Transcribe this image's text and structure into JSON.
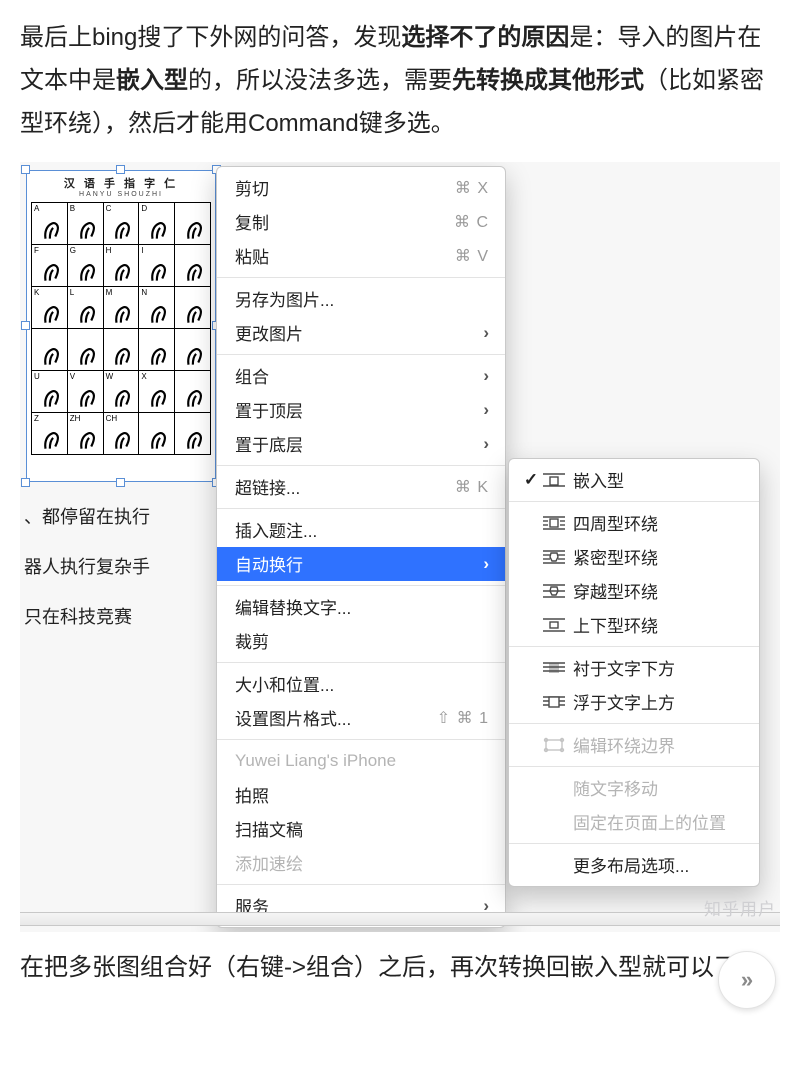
{
  "article": {
    "p1_a": "最后上bing搜了下外网的问答，发现",
    "p1_b": "选择不了的原因",
    "p1_c": "是：导入的图片在文本中是",
    "p1_d": "嵌入型",
    "p1_e": "的，所以没法多选，需要",
    "p1_f": "先转换成其他形式",
    "p1_g": "（比如紧密型环绕），然后才能用Command键多选。",
    "p2": "在把多张图组合好（右键->组合）之后，再次转换回嵌入型就可以了。"
  },
  "sign_chart": {
    "title": "汉 语 手 指 字 仁",
    "subtitle": "HANYU  SHOUZHI",
    "cells": [
      "A",
      "B",
      "C",
      "D",
      "",
      "F",
      "G",
      "H",
      "I",
      "",
      "K",
      "L",
      "M",
      "N",
      "",
      "",
      "",
      "",
      "",
      "",
      "U",
      "V",
      "W",
      "X",
      "",
      "Z",
      "ZH",
      "CH",
      "",
      ""
    ]
  },
  "doc_lines": {
    "l1": "、都停留在执行",
    "l2": "器人执行复杂手",
    "l3": "只在科技竞赛"
  },
  "menu": {
    "cut": {
      "label": "剪切",
      "shortcut": "⌘ X"
    },
    "copy": {
      "label": "复制",
      "shortcut": "⌘ C"
    },
    "paste": {
      "label": "粘贴",
      "shortcut": "⌘ V"
    },
    "save_as_picture": {
      "label": "另存为图片..."
    },
    "change_picture": {
      "label": "更改图片"
    },
    "group": {
      "label": "组合"
    },
    "bring_front": {
      "label": "置于顶层"
    },
    "send_back": {
      "label": "置于底层"
    },
    "hyperlink": {
      "label": "超链接...",
      "shortcut": "⌘ K"
    },
    "insert_caption": {
      "label": "插入题注..."
    },
    "wrap_text": {
      "label": "自动换行"
    },
    "edit_alt_text": {
      "label": "编辑替换文字..."
    },
    "crop": {
      "label": "裁剪"
    },
    "size_position": {
      "label": "大小和位置..."
    },
    "format_picture": {
      "label": "设置图片格式...",
      "shortcut": "⇧ ⌘ 1"
    },
    "iphone": {
      "label": "Yuwei Liang's iPhone"
    },
    "take_photo": {
      "label": "拍照"
    },
    "scan_documents": {
      "label": "扫描文稿"
    },
    "add_sketch": {
      "label": "添加速绘"
    },
    "services": {
      "label": "服务"
    }
  },
  "submenu": {
    "inline": "嵌入型",
    "square": "四周型环绕",
    "tight": "紧密型环绕",
    "through": "穿越型环绕",
    "top_bottom": "上下型环绕",
    "behind": "衬于文字下方",
    "front": "浮于文字上方",
    "edit_points": "编辑环绕边界",
    "move_with_text": "随文字移动",
    "fix_on_page": "固定在页面上的位置",
    "more_layout": "更多布局选项..."
  },
  "watermark": "知乎用户",
  "fab": "»"
}
